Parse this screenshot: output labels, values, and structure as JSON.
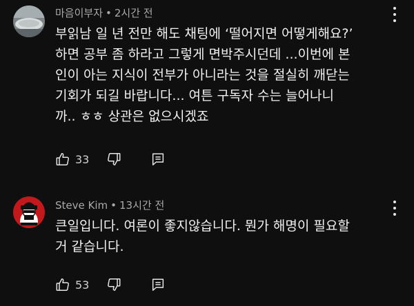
{
  "comments": [
    {
      "author": "마음이부자",
      "separator": "•",
      "time": "2시간 전",
      "text": "부읽남 일 년 전만 해도 채팅에 ‘떨어지면 어떻게해요?’\n하면 공부 좀 하라고 그렇게 면박주시던데 ...이번에 본\n인이 아는 지식이 전부가 아니라는 것을 절실히 깨닫는\n기회가 되길 바랍니다... 여튼  구독자 수는 늘어나니\n까.. ㅎㅎ 상관은 없으시겠죠",
      "likes": "33"
    },
    {
      "author": "Steve Kim",
      "separator": "•",
      "time": "13시간 전",
      "text": "큰일입니다. 여론이 좋지않습니다. 뭔가 해명이 필요할\n거 같습니다.",
      "likes": "53"
    }
  ],
  "icons": {
    "like": "thumbs-up-icon",
    "dislike": "thumbs-down-icon",
    "reply": "reply-comment-icon",
    "menu": "more-vertical-icon"
  }
}
